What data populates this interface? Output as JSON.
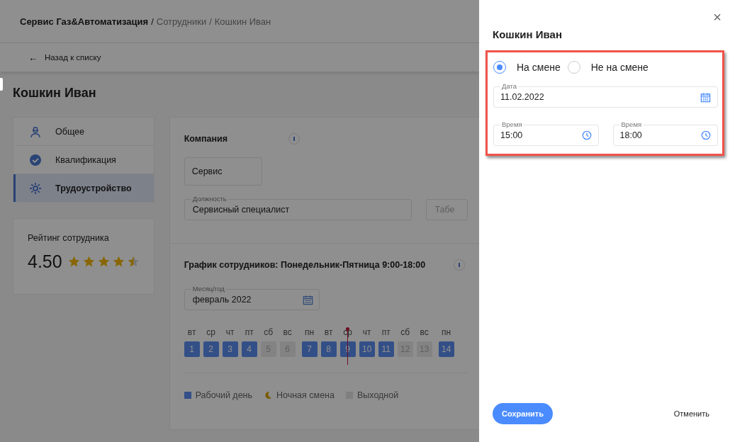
{
  "breadcrumb": {
    "items": [
      "Сервис Газ&Автоматизация",
      "Сотрудники",
      "Кошкин Иван"
    ],
    "separator": "/"
  },
  "back_link": {
    "icon": "←",
    "label": "Назад к списку"
  },
  "page_title": "Кошкин Иван",
  "sidebar": {
    "items": [
      {
        "label": "Общее",
        "selected": false
      },
      {
        "label": "Квалификация",
        "selected": false
      },
      {
        "label": "Трудоустройство",
        "selected": true
      }
    ]
  },
  "rating": {
    "title": "Рейтинг сотрудника",
    "value": "4.50",
    "stars": 4.5
  },
  "company": {
    "title": "Компания",
    "company_value": "Сервис",
    "position_label": "Должность",
    "position_value": "Сервисный специалист",
    "field_3_placeholder": "Табе"
  },
  "schedule": {
    "title": "График сотрудников: Понедельник-Пятница 9:00-18:00",
    "month_label": "Месяц/год",
    "month_value": "февраль 2022",
    "weeks": [
      {
        "days": [
          {
            "dow": "вт",
            "day": "1",
            "kind": "work",
            "today": false
          },
          {
            "dow": "ср",
            "day": "2",
            "kind": "work",
            "today": false
          },
          {
            "dow": "чт",
            "day": "3",
            "kind": "work",
            "today": false
          },
          {
            "dow": "пт",
            "day": "4",
            "kind": "work",
            "today": false
          },
          {
            "dow": "сб",
            "day": "5",
            "kind": "off",
            "today": false
          },
          {
            "dow": "вс",
            "day": "6",
            "kind": "off",
            "today": false
          }
        ]
      },
      {
        "days": [
          {
            "dow": "пн",
            "day": "7",
            "kind": "work",
            "today": false
          },
          {
            "dow": "вт",
            "day": "8",
            "kind": "work",
            "today": false
          },
          {
            "dow": "ср",
            "day": "9",
            "kind": "work",
            "today": true
          },
          {
            "dow": "чт",
            "day": "10",
            "kind": "work",
            "today": false
          },
          {
            "dow": "пт",
            "day": "11",
            "kind": "work",
            "today": false
          },
          {
            "dow": "сб",
            "day": "12",
            "kind": "off",
            "today": false
          },
          {
            "dow": "вс",
            "day": "13",
            "kind": "off",
            "today": false
          }
        ]
      },
      {
        "days": [
          {
            "dow": "пн",
            "day": "14",
            "kind": "work",
            "today": false
          }
        ]
      }
    ],
    "legend": [
      {
        "label": "Рабочий день",
        "kind": "work"
      },
      {
        "label": "Ночная смена",
        "kind": "night"
      },
      {
        "label": "Выходной",
        "kind": "off"
      }
    ]
  },
  "drawer": {
    "title": "Кошкин Иван",
    "close": "×",
    "shift_options": [
      {
        "label": "На смене",
        "selected": true
      },
      {
        "label": "Не на смене",
        "selected": false
      }
    ],
    "date": {
      "label": "Дата",
      "value": "11.02.2022"
    },
    "times": [
      {
        "label": "Время",
        "value": "15:00"
      },
      {
        "label": "Время",
        "value": "18:00"
      }
    ],
    "save": "Сохранить",
    "cancel": "Отменить"
  }
}
